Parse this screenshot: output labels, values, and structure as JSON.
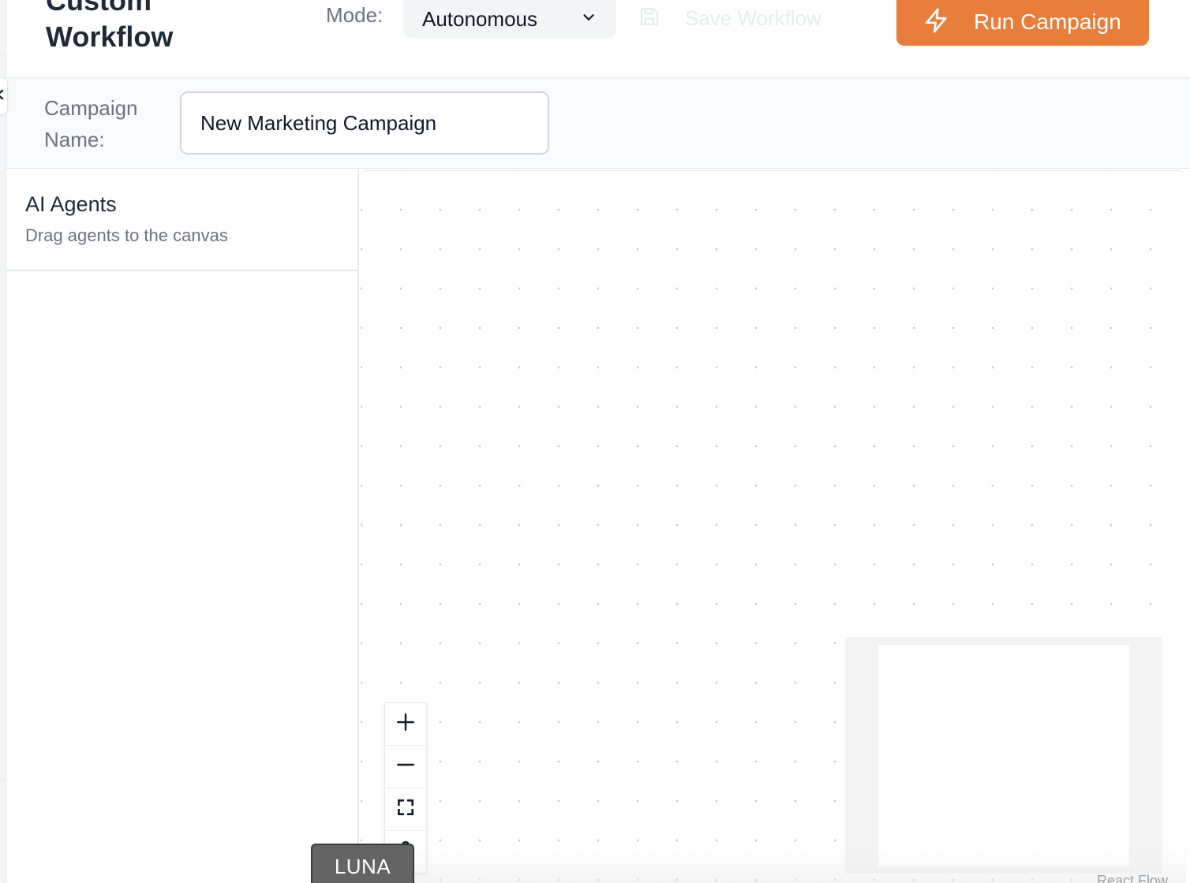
{
  "header": {
    "title": "Custom Workflow",
    "mode_label": "Mode:",
    "mode_value": "Autonomous",
    "save_label": "Save Workflow",
    "run_label": "Run Campaign"
  },
  "campaign": {
    "label": "Campaign Name:",
    "value": "New Marketing Campaign"
  },
  "sidebar": {
    "title": "AI Agents",
    "subtitle": "Drag agents to the canvas"
  },
  "canvas": {
    "attribution": "React Flow",
    "controls": [
      "zoom-in-icon",
      "zoom-out-icon",
      "fit-view-icon",
      "lock-icon"
    ]
  },
  "luna_label": "LUNA",
  "colors": {
    "accent": "#e97d3c",
    "border": "#e5e7eb",
    "muted_text": "#6b7280"
  }
}
